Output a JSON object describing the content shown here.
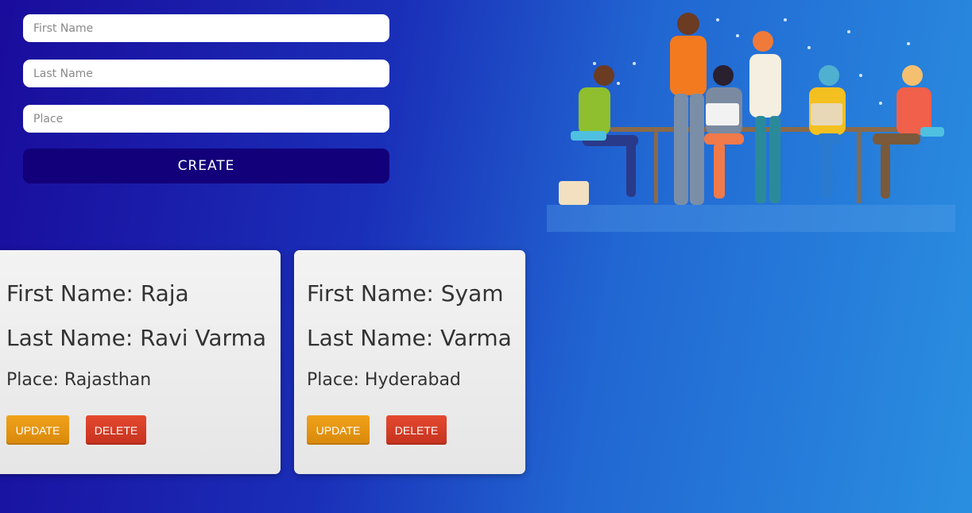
{
  "form": {
    "first_name_placeholder": "First Name",
    "last_name_placeholder": "Last Name",
    "place_placeholder": "Place",
    "create_label": "CREATE"
  },
  "cards": [
    {
      "first_name": "First Name: Raja",
      "last_name": "Last Name: Ravi Varma",
      "place": "Place: Rajasthan",
      "update_label": "UPDATE",
      "delete_label": "DELETE"
    },
    {
      "first_name": "First Name: Syam",
      "last_name": "Last Name: Varma",
      "place": "Place: Hyderabad",
      "update_label": "UPDATE",
      "delete_label": "DELETE"
    }
  ],
  "illustration": {
    "icon": "team-working-illustration"
  },
  "colors": {
    "create_button": "#12007a",
    "update_button": "#e3930f",
    "delete_button": "#d53d26",
    "card_bg": "#eeeeee"
  }
}
